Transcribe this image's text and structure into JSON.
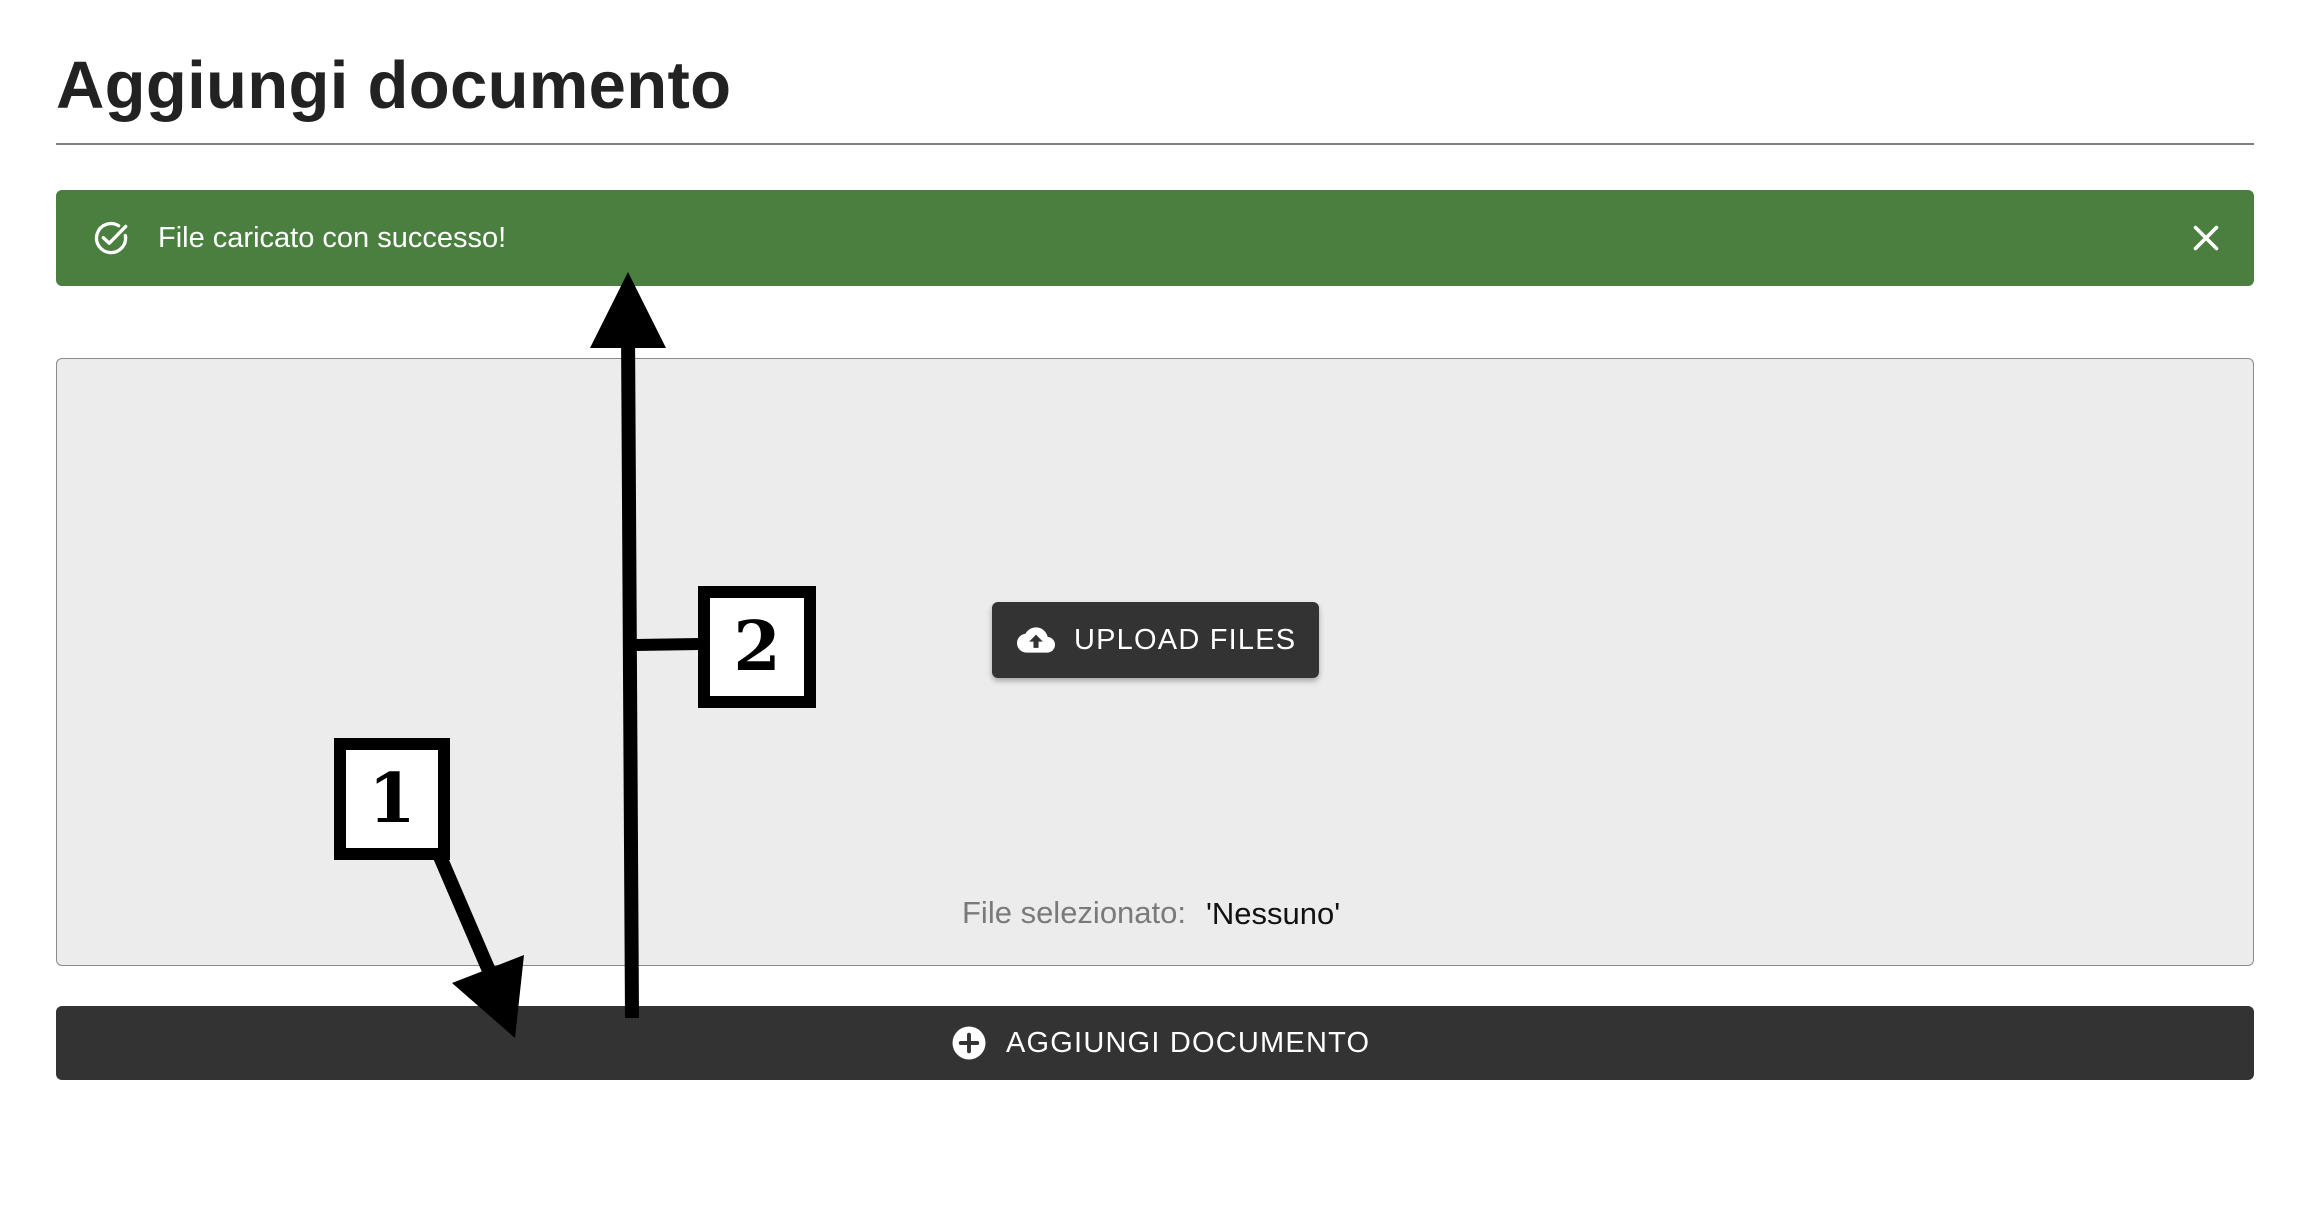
{
  "page": {
    "title": "Aggiungi documento"
  },
  "alert": {
    "message": "File caricato con successo!",
    "type": "success",
    "color": "#4a7f40",
    "icon": "check-circle-icon",
    "close_icon": "close-icon"
  },
  "dropzone": {
    "upload_button": {
      "label": "UPLOAD FILES",
      "icon": "cloud-upload-icon"
    },
    "selected_file_label": "File selezionato:",
    "selected_file_value": "'Nessuno'"
  },
  "add_button": {
    "label": "AGGIUNGI DOCUMENTO",
    "icon": "plus-circle-icon",
    "color": "#333333"
  },
  "annotations": {
    "callouts": [
      {
        "number": "1"
      },
      {
        "number": "2"
      }
    ]
  }
}
